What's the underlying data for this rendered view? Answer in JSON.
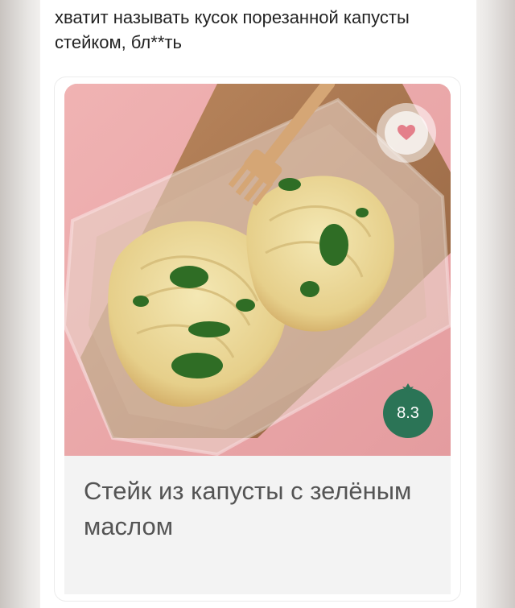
{
  "post": {
    "caption": "хватит называть кусок порезанной капусты стейком, бл**ть"
  },
  "product": {
    "title": "Стейк из капусты с зелёным маслом",
    "rating": "8.3",
    "rating_color": "#2b7456",
    "favorite_icon": "heart-icon"
  }
}
